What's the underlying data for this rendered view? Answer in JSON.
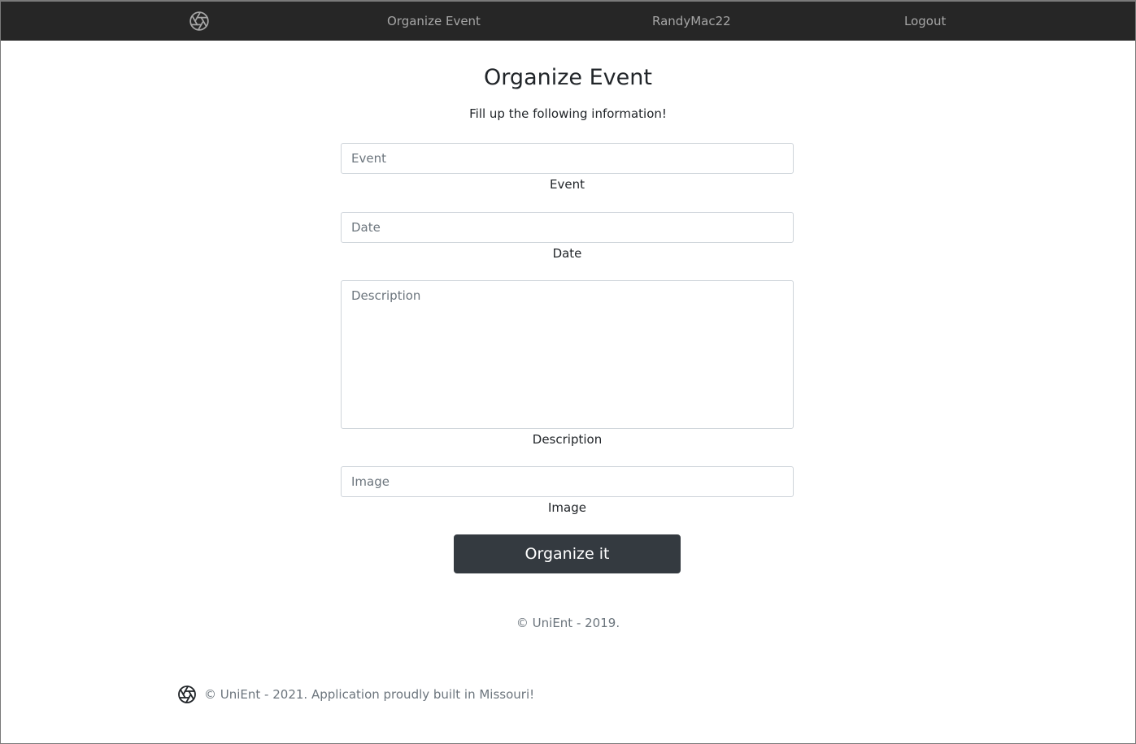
{
  "navbar": {
    "logo_icon": "aperture-icon",
    "organize_label": "Organize Event",
    "user_label": "RandyMac22",
    "logout_label": "Logout",
    "background": "#262626",
    "link_color": "#a6a6a6"
  },
  "main": {
    "title": "Organize Event",
    "subtitle": "Fill up the following information!"
  },
  "form": {
    "event": {
      "placeholder": "Event",
      "label": "Event",
      "value": ""
    },
    "date": {
      "placeholder": "Date",
      "label": "Date",
      "value": ""
    },
    "description": {
      "placeholder": "Description",
      "label": "Description",
      "value": ""
    },
    "image": {
      "placeholder": "Image",
      "label": "Image",
      "value": ""
    },
    "submit_label": "Organize it",
    "submit_color": "#343a40"
  },
  "copyright_center": "© UniEnt - 2019.",
  "footer": {
    "logo_icon": "aperture-icon",
    "text": "© UniEnt - 2021. Application proudly built in Missouri!"
  }
}
